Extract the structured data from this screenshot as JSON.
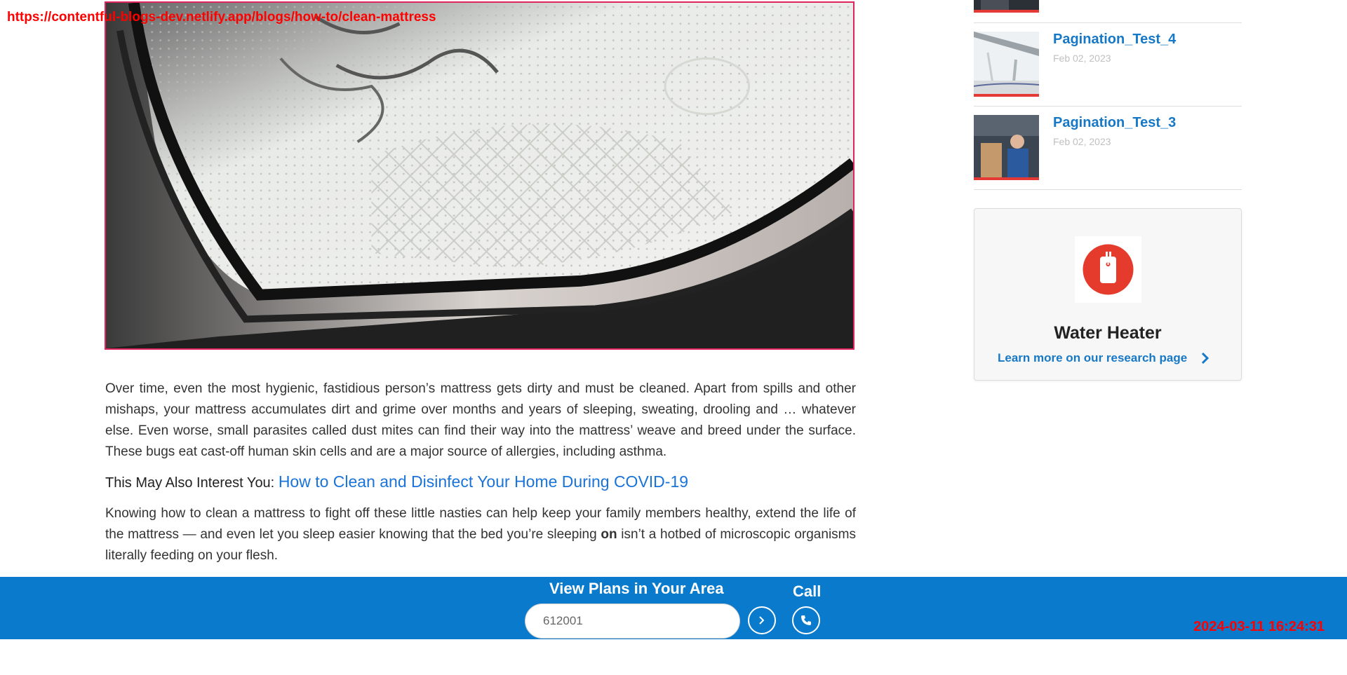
{
  "overlay": {
    "url": "https://contentful-blogs-dev.netlify.app/blogs/how-to/clean-mattress",
    "timestamp": "2024-03-11 16:24:31",
    "color": "#ff0000"
  },
  "article": {
    "hero_image_alt": "Close-up of a quilted mattress corner",
    "paragraph_1": "Over time, even the most hygienic, fastidious person’s mattress gets dirty and must be cleaned. Apart from spills and other mishaps, your mattress accumulates dirt and grime over months and years of sleeping, sweating, drooling and … whatever else. Even worse, small parasites called dust mites can find their way into the mattress’ weave and breed under the surface. These bugs eat cast-off human skin cells and are a major source of allergies, including asthma.",
    "interest_label": "This May Also Interest You:",
    "interest_link": "How to Clean and Disinfect Your Home During COVID-19",
    "paragraph_2_before": "Knowing how to clean a mattress to fight off these little nasties can help keep your family members healthy, extend the life of the mattress — and even let you sleep easier knowing that the bed you’re sleeping",
    "paragraph_2_bold": "on",
    "paragraph_2_after": "isn’t a hotbed of microscopic organisms literally feeding on your flesh."
  },
  "sidebar": {
    "items": [
      {
        "title": "Pagination_Test_4",
        "date": "Feb 02, 2023"
      },
      {
        "title": "Pagination_Test_3",
        "date": "Feb 02, 2023"
      }
    ]
  },
  "research_card": {
    "title": "Water Heater",
    "link_label": "Learn more on our research page",
    "icon": "water-heater-icon",
    "icon_color": "#e53b2c"
  },
  "bottom_bar": {
    "heading": "View Plans in Your Area",
    "zip_value": "612001",
    "call_label": "Call",
    "background": "#0a7acc"
  },
  "colors": {
    "link": "#1778c6",
    "accent_red": "#e53935"
  }
}
